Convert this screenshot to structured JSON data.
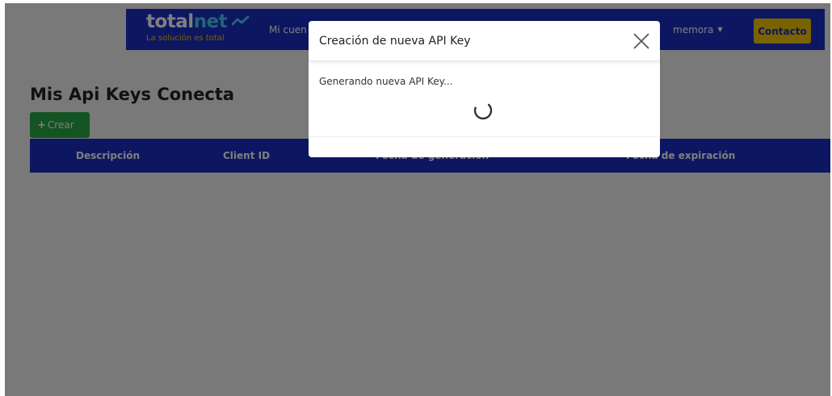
{
  "header": {
    "brand_main": "total",
    "brand_accent": "net",
    "brand_tagline": "La solución es total",
    "nav_link": "Mi cuen",
    "user_menu": "memora",
    "contact_label": "Contacto"
  },
  "page": {
    "title": "Mis Api Keys Conecta",
    "create_label": "Crear",
    "table": {
      "columns": [
        "Descripción",
        "Client ID",
        "Fecha de generación",
        "Fecha de expiración"
      ]
    }
  },
  "modal": {
    "title": "Creación de nueva API Key",
    "message": "Generando nueva API Key..."
  },
  "colors": {
    "primary": "#1a2fc2",
    "accent_yellow": "#f2c400",
    "success": "#28a745",
    "brand_accent": "#48c6f0",
    "overlay": "rgba(0,0,0,0.5)"
  },
  "icons": {
    "brand_mark": "trend-line-icon",
    "dropdown": "caret-down-icon",
    "create": "plus-icon",
    "close": "close-icon",
    "loading": "spinner-icon"
  }
}
